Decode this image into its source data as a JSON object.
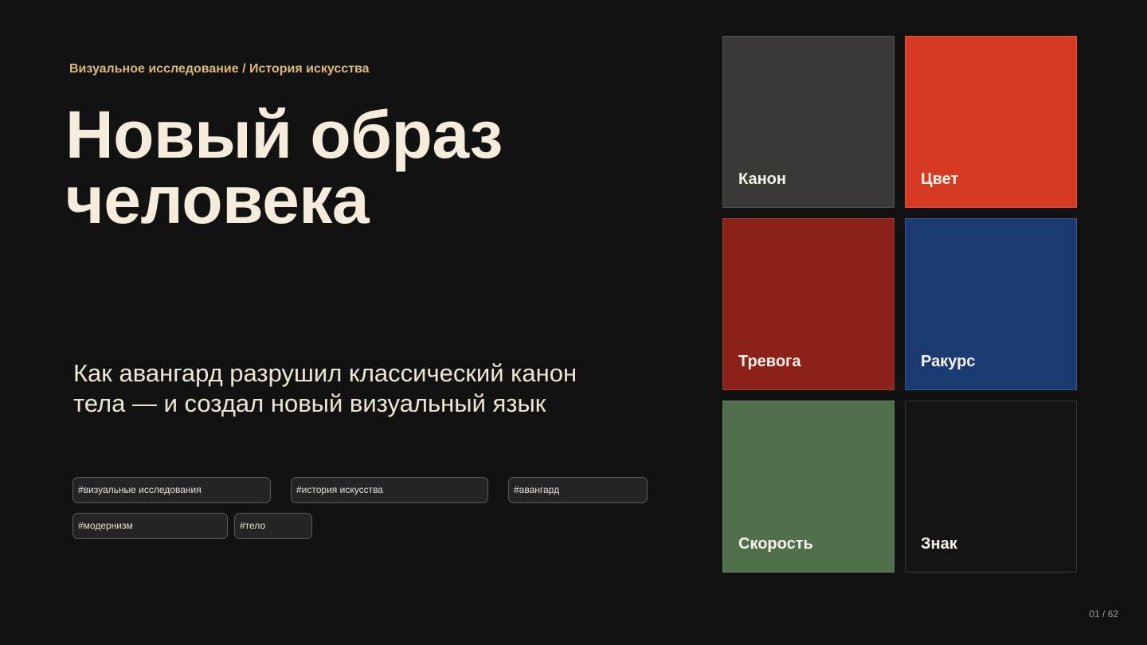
{
  "header": {
    "kicker": "Визуальное исследование / История искусства"
  },
  "title": {
    "line1": "Новый образ",
    "line2": "человека"
  },
  "subtitle": {
    "line1": "Как авангард разрушил классический канон",
    "line2": "тела — и создал новый визуальный язык"
  },
  "tags": [
    "#визуальные исследования",
    "#история искусства",
    "#авангард",
    "#модернизм",
    "#тело"
  ],
  "tiles": [
    {
      "label": "Канон",
      "color": "#3a3935"
    },
    {
      "label": "Цвет",
      "color": "#d63a22"
    },
    {
      "label": "Тревога",
      "color": "#8c2119"
    },
    {
      "label": "Ракурс",
      "color": "#1c3a72"
    },
    {
      "label": "Скорость",
      "color": "#50704b"
    },
    {
      "label": "Знак",
      "color": "#141414"
    }
  ],
  "pagination": {
    "text": "01 / 62"
  },
  "colors": {
    "background": "#121212",
    "accent": "#d9b87a",
    "text": "#f5ecdc"
  }
}
